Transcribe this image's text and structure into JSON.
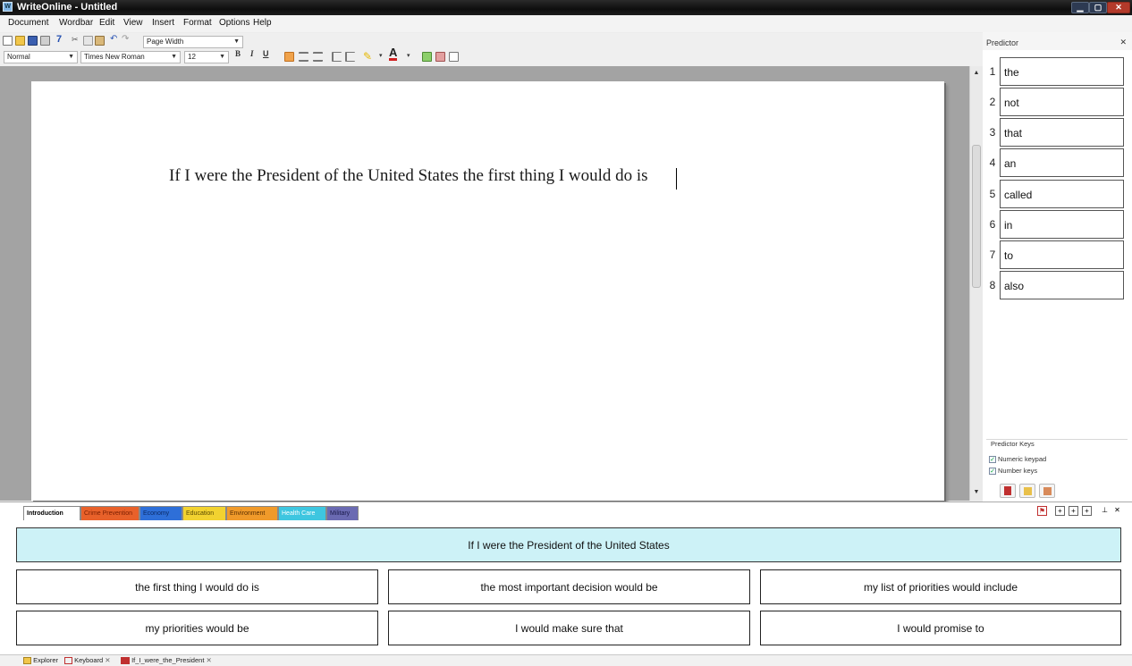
{
  "window": {
    "title": "WriteOnline - Untitled"
  },
  "menu": [
    "Document",
    "Wordbar",
    "Edit",
    "View",
    "Insert",
    "Format",
    "Options",
    "Help"
  ],
  "toolbar": {
    "zoom": "Page Width"
  },
  "format_bar": {
    "style": "Normal",
    "font": "Times New Roman",
    "size": "12",
    "bold": "B",
    "italic": "I",
    "underline": "U",
    "font_color_letter": "A"
  },
  "document": {
    "text": "If I were the President of the United States the first thing I would do is "
  },
  "predictor": {
    "title": "Predictor",
    "items": [
      {
        "num": "1",
        "word": "the"
      },
      {
        "num": "2",
        "word": "not"
      },
      {
        "num": "3",
        "word": "that"
      },
      {
        "num": "4",
        "word": "an"
      },
      {
        "num": "5",
        "word": "called"
      },
      {
        "num": "6",
        "word": "in"
      },
      {
        "num": "7",
        "word": "to"
      },
      {
        "num": "8",
        "word": "also"
      }
    ],
    "keys_title": "Predictor Keys",
    "numeric_keypad": "Numeric keypad",
    "number_keys": "Number keys"
  },
  "wordbar": {
    "tabs": [
      {
        "label": "Introduction",
        "color": "#ffffff"
      },
      {
        "label": "Crime Prevention",
        "color": "#e8612a"
      },
      {
        "label": "Economy",
        "color": "#2e6fd8"
      },
      {
        "label": "Education",
        "color": "#f2d230"
      },
      {
        "label": "Environment",
        "color": "#f09a2a"
      },
      {
        "label": "Health Care",
        "color": "#3ec6e0"
      },
      {
        "label": "Military",
        "color": "#6a6ab2"
      }
    ],
    "heading": "If I were the President of the United States",
    "phrases": [
      "the first thing I would do is",
      "the most important decision would be",
      "my list of priorities would include",
      "my priorities would be",
      "I would make sure that",
      "I would promise to"
    ]
  },
  "status_tabs": [
    "Explorer",
    "Keyboard",
    "If_I_were_the_President"
  ],
  "colors": {
    "highlight": "#cdf2f7",
    "accent": "#7fb5e6"
  }
}
